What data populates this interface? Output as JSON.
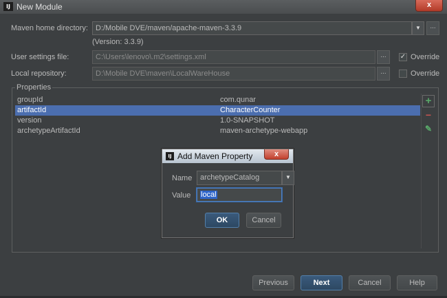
{
  "window": {
    "title": "New Module",
    "close": "x"
  },
  "maven": {
    "home_label": "Maven home directory:",
    "home_value": "D:/Mobile DVE/maven/apache-maven-3.3.9",
    "version_text": "(Version: 3.3.9)",
    "settings_label": "User settings file:",
    "settings_value": "C:\\Users\\lenovo\\.m2\\settings.xml",
    "settings_override_label": "Override",
    "settings_override_checked": true,
    "repo_label": "Local repository:",
    "repo_value": "D:\\Mobile DVE\\maven\\LocalWareHouse",
    "repo_override_label": "Override",
    "repo_override_checked": false,
    "browse_label": "..."
  },
  "properties": {
    "title": "Properties",
    "rows": [
      {
        "key": "groupId",
        "value": "com.qunar",
        "selected": false
      },
      {
        "key": "artifactId",
        "value": "CharacterCounter",
        "selected": true
      },
      {
        "key": "version",
        "value": "1.0-SNAPSHOT",
        "selected": false
      },
      {
        "key": "archetypeArtifactId",
        "value": "maven-archetype-webapp",
        "selected": false
      }
    ],
    "tools": {
      "add": "+",
      "remove": "−",
      "edit": "✎"
    }
  },
  "dialog": {
    "title": "Add Maven Property",
    "close": "x",
    "name_label": "Name",
    "name_value": "archetypeCatalog",
    "value_label": "Value",
    "value_value": "local",
    "ok_label": "OK",
    "cancel_label": "Cancel"
  },
  "footer": {
    "previous": "Previous",
    "next": "Next",
    "cancel": "Cancel",
    "help": "Help"
  },
  "colors": {
    "background": "#3c3f41",
    "selection": "#4b6eaf",
    "primary_button": "#2d4862",
    "add_icon": "#59a869",
    "remove_icon": "#c75450"
  }
}
